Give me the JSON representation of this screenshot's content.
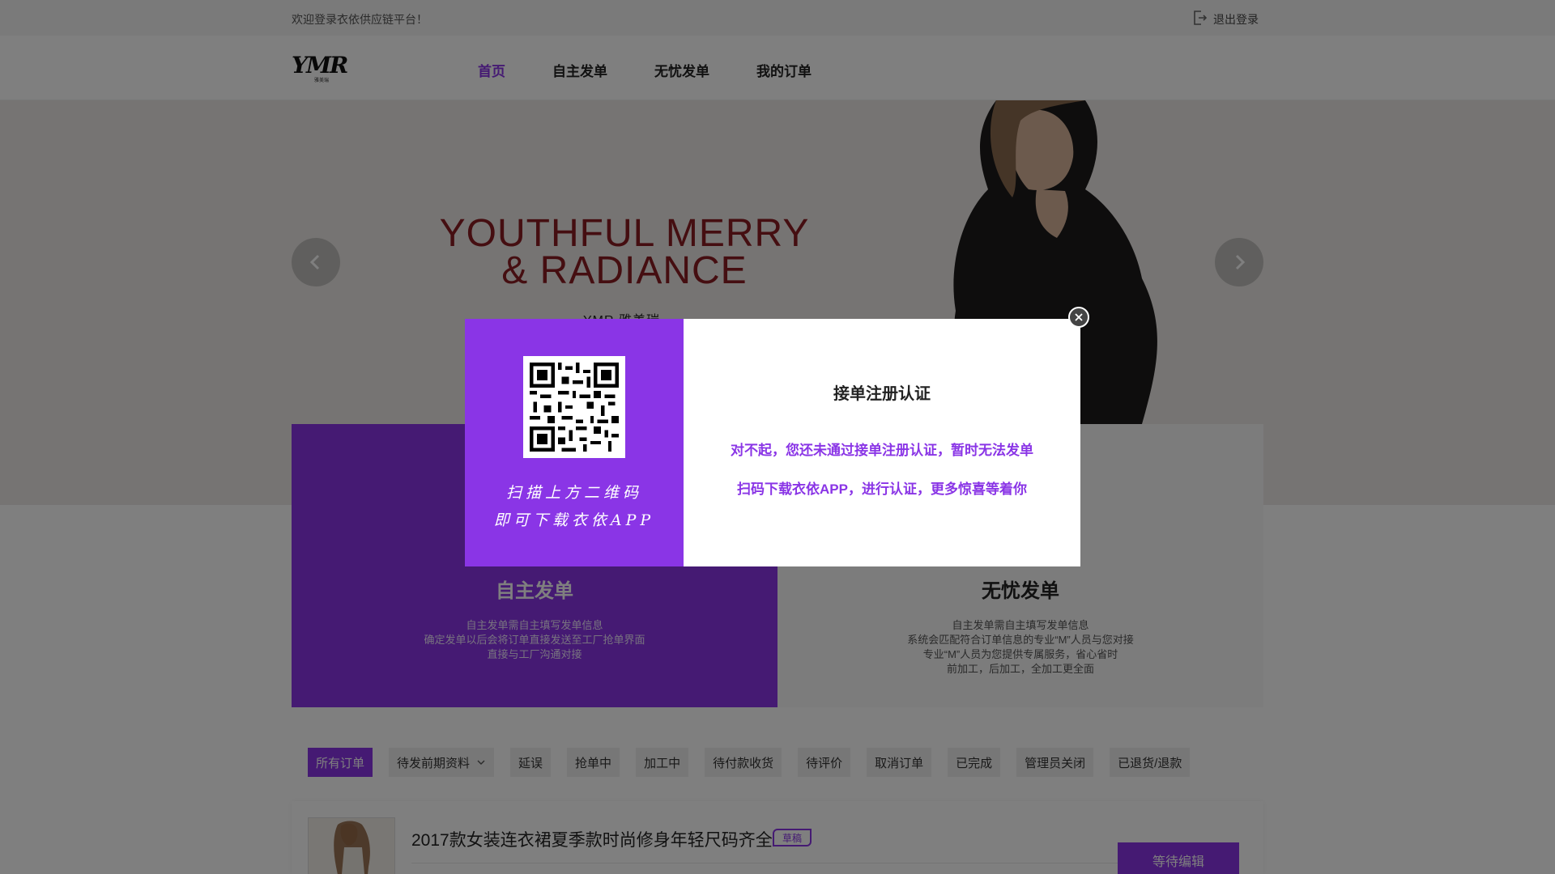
{
  "topbar": {
    "welcome": "欢迎登录衣依供应链平台！",
    "logout_label": "退出登录",
    "logout_icon": "logout-icon"
  },
  "header": {
    "logo_text": "YMR",
    "logo_sub": "雅美瑞",
    "nav": [
      {
        "label": "首页",
        "active": true
      },
      {
        "label": "自主发单",
        "active": false
      },
      {
        "label": "无忧发单",
        "active": false
      },
      {
        "label": "我的订单",
        "active": false
      }
    ]
  },
  "banner": {
    "slogan_line1": "YOUTHFUL  MERRY",
    "slogan_line2": "& RADIANCE",
    "brand": "YMR 雅美瑞",
    "prev_icon": "chevron-left-icon",
    "next_icon": "chevron-right-icon"
  },
  "cards": [
    {
      "title": "自主发单",
      "desc": [
        "自主发单需自主填写发单信息",
        "确定发单以后会将订单直接发送至工厂抢单界面",
        "直接与工厂沟通对接"
      ]
    },
    {
      "title": "无忧发单",
      "desc": [
        "自主发单需自主填写发单信息",
        "系统会匹配符合订单信息的专业“M”人员与您对接",
        "专业“M”人员为您提供专属服务，省心省时",
        "前加工，后加工，全加工更全面"
      ]
    }
  ],
  "order_tabs": [
    {
      "label": "所有订单",
      "active": true
    },
    {
      "label": "待发前期资料",
      "dropdown": true
    },
    {
      "label": "延误"
    },
    {
      "label": "抢单中"
    },
    {
      "label": "加工中"
    },
    {
      "label": "待付款收货"
    },
    {
      "label": "待评价"
    },
    {
      "label": "取消订单"
    },
    {
      "label": "已完成"
    },
    {
      "label": "管理员关闭"
    },
    {
      "label": "已退货/退款"
    }
  ],
  "order": {
    "title": "2017款女装连衣裙夏季款时尚修身年轻尺码齐全",
    "badge": "草稿",
    "status_button": "等待编辑"
  },
  "modal": {
    "qr_caption_line1": "扫描上方二维码",
    "qr_caption_line2": "即可下载衣依APP",
    "title": "接单注册认证",
    "msg1": "对不起，您还未通过接单注册认证，暂时无法发单",
    "msg2": "扫码下载衣依APP，进行认证，更多惊喜等着你",
    "close_icon": "close-icon"
  },
  "colors": {
    "accent": "#8a35e6",
    "slogan": "#8a1c22",
    "overlay": "rgba(0,0,0,0.5)"
  }
}
